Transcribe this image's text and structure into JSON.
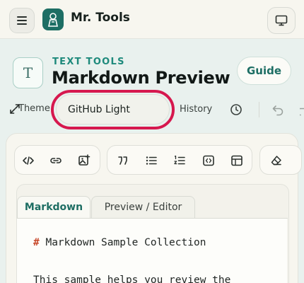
{
  "header": {
    "brand": "Mr. Tools"
  },
  "tool": {
    "category": "TEXT TOOLS",
    "title": "Markdown Preview",
    "icon_letter": "T",
    "guide_label": "Guide"
  },
  "controls": {
    "theme_label": "Theme",
    "theme_value": "GitHub Light",
    "history_label": "History"
  },
  "tabs": [
    {
      "label": "Markdown",
      "active": true
    },
    {
      "label": "Preview / Editor",
      "active": false
    }
  ],
  "editor": {
    "heading_marker": "#",
    "line1": " Markdown Sample Collection",
    "line2": "This sample helps you review the"
  },
  "colors": {
    "accent": "#1e8a7c",
    "highlight": "#d6184e"
  }
}
